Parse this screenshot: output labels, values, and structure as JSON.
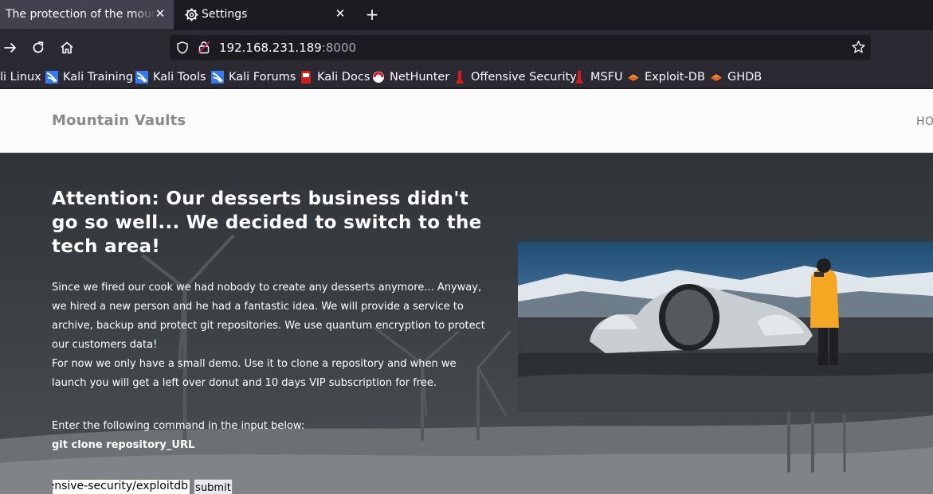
{
  "browser": {
    "tabs": [
      {
        "title": "The protection of the mountain",
        "active": true
      },
      {
        "title": "Settings",
        "active": false
      }
    ],
    "url": {
      "host": "192.168.231.189",
      "port": ":8000"
    },
    "bookmarks": [
      {
        "label": "li Linux",
        "icon": "kali-icon"
      },
      {
        "label": "Kali Training",
        "icon": "kali-icon"
      },
      {
        "label": "Kali Tools",
        "icon": "kali-icon"
      },
      {
        "label": "Kali Forums",
        "icon": "kali-icon"
      },
      {
        "label": "Kali Docs",
        "icon": "kali-docs-icon"
      },
      {
        "label": "NetHunter",
        "icon": "nethunter-icon"
      },
      {
        "label": "Offensive Security",
        "icon": "offsec-icon"
      },
      {
        "label": "MSFU",
        "icon": "offsec-icon"
      },
      {
        "label": "Exploit-DB",
        "icon": "exploitdb-icon"
      },
      {
        "label": "GHDB",
        "icon": "exploitdb-icon"
      }
    ]
  },
  "site": {
    "brand": "Mountain Vaults",
    "nav_home": "HO"
  },
  "hero": {
    "heading": "Attention: Our desserts business didn't go so well... We decided to switch to the tech area!",
    "paragraph1": "Since we fired our cook we had nobody to create any desserts anymore... Anyway, we hired a new person and he had a fantastic idea. We will provide a service to archive, backup and protect git repositories. We use quantum encryption to protect our customers data!",
    "paragraph2": "For now we only have a small demo. Use it to clone a repository and when we launch you will get a left over donut and 10 days VIP subscription for free.",
    "instruction": "Enter the following command in the input below:",
    "command": "git clone repository_URL",
    "input_value": "'fensive-security/exploitdb",
    "submit_label": "submit"
  },
  "colors": {
    "chrome_dark": "#1c1b22",
    "chrome_toolbar": "#2b2a33",
    "active_tab": "#42414d",
    "header_bg": "#fbfbfb",
    "brand_gray": "#8a8a8a"
  }
}
